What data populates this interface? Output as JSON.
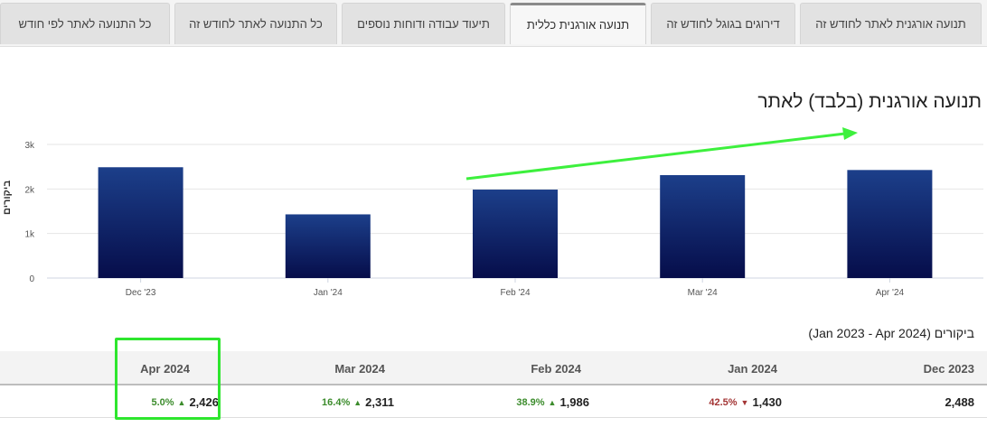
{
  "tabs": [
    {
      "label": "תנועה אורגנית לאתר לחודש זה",
      "active": false
    },
    {
      "label": "דירוגים בגוגל לחודש זה",
      "active": false
    },
    {
      "label": "תנועה אורגנית כללית",
      "active": true
    },
    {
      "label": "תיעוד עבודה ודוחות נוספים",
      "active": false
    },
    {
      "label": "כל התנועה לאתר לחודש זה",
      "active": false
    },
    {
      "label": "כל התנועה לאתר לפי חודש",
      "active": false
    }
  ],
  "chart_data": {
    "type": "bar",
    "title": "תנועה אורגנית (בלבד) לאתר",
    "ylabel": "ביקורים",
    "xlabel": "",
    "categories": [
      "Dec '23",
      "Jan '24",
      "Feb '24",
      "Mar '24",
      "Apr '24"
    ],
    "values": [
      2488,
      1430,
      1986,
      2311,
      2426
    ],
    "ylim": [
      0,
      3000
    ],
    "yticks": [
      "0",
      "1k",
      "2k",
      "3k"
    ],
    "grid": true,
    "bar_color_top": "#1c3f8a",
    "bar_color_bottom": "#060d4a",
    "annotation": {
      "type": "arrow",
      "color": "#3df03d",
      "meaning": "upward trend"
    }
  },
  "table": {
    "caption": "ביקורים (Jan 2023 - Apr 2024)",
    "columns": [
      "Dec 2023",
      "Jan 2024",
      "Feb 2024",
      "Mar 2024",
      "Apr 2024"
    ],
    "cells": [
      {
        "value": "2,488",
        "change": "",
        "direction": "none"
      },
      {
        "value": "1,430",
        "change": "42.5%",
        "direction": "down"
      },
      {
        "value": "1,986",
        "change": "38.9%",
        "direction": "up"
      },
      {
        "value": "2,311",
        "change": "16.4%",
        "direction": "up"
      },
      {
        "value": "2,426",
        "change": "5.0%",
        "direction": "up"
      }
    ],
    "highlight_color": "#2ee62e"
  }
}
